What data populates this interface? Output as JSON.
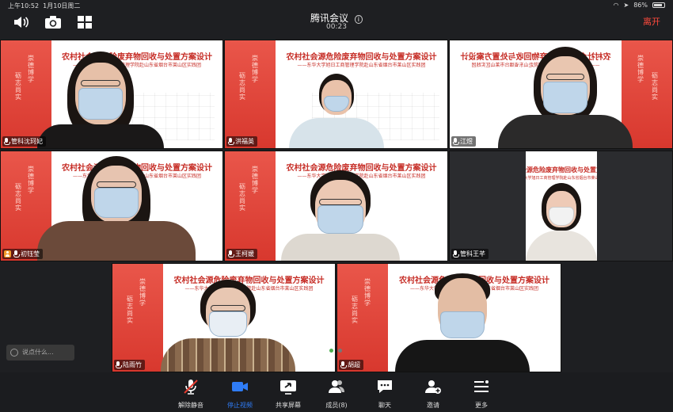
{
  "status": {
    "time": "上午10:52",
    "date": "1月10日周二",
    "battery": "86%",
    "battery_level": 0.86
  },
  "header": {
    "title": "腾讯会议",
    "info_icon": "info-icon",
    "timer": "00:23",
    "leave": "离开"
  },
  "slide": {
    "title": "农村社会源危险废弃物回收与处置方案设计",
    "subtitle": "——东华大学旭日工商管理学院赴山东省烟台市莱山区实践团",
    "side_left": "崇德博学",
    "side_right": "砺志尚实"
  },
  "participants": [
    {
      "name": "管科沈珂妃"
    },
    {
      "name": "洪福英"
    },
    {
      "name": "江煜"
    },
    {
      "name": "初钰莹"
    },
    {
      "name": "王柯媛"
    },
    {
      "name": "管科王芊"
    },
    {
      "name": "陆雨竹"
    },
    {
      "name": "胡超"
    }
  ],
  "chat": {
    "placeholder": "说点什么..."
  },
  "toolbar": [
    {
      "label": "解除静音",
      "icon": "muted-mic-icon"
    },
    {
      "label": "停止视频",
      "icon": "video-camera-icon",
      "color": "#2f7cf6"
    },
    {
      "label": "共享屏幕",
      "icon": "share-screen-icon"
    },
    {
      "label": "成员(8)",
      "icon": "members-icon"
    },
    {
      "label": "聊天",
      "icon": "chat-icon"
    },
    {
      "label": "邀请",
      "icon": "invite-icon"
    },
    {
      "label": "更多",
      "icon": "more-menu-icon"
    }
  ],
  "colors": {
    "accent": "#2f7cf6",
    "leave": "#ff4a3d",
    "slide_red": "#c62d26"
  }
}
